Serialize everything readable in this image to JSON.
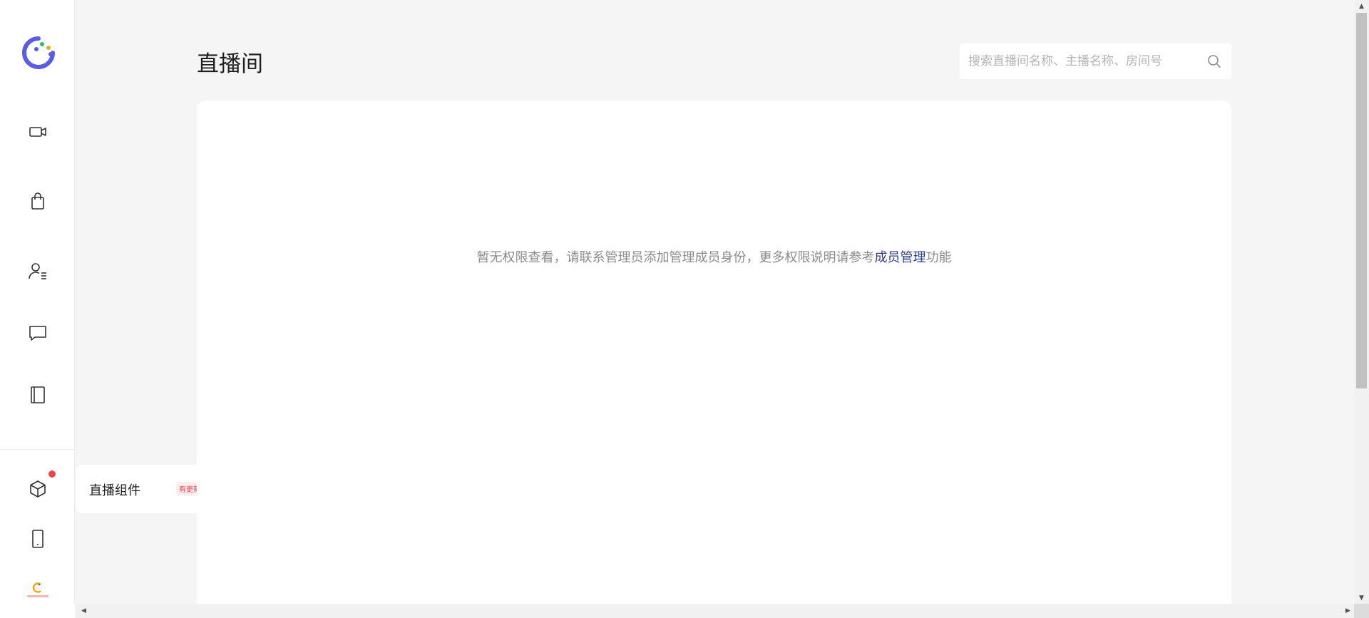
{
  "header": {
    "title": "直播间"
  },
  "search": {
    "placeholder": "搜索直播间名称、主播名称、房间号"
  },
  "main": {
    "empty_text": "暂无权限查看，请联系管理员添加管理成员身份，更多权限说明请参考",
    "empty_link": "成员管理",
    "empty_suffix": "功能"
  },
  "sidebar": {
    "items": [
      {
        "icon": "video-camera-icon"
      },
      {
        "icon": "shopping-bag-icon"
      },
      {
        "icon": "user-list-icon"
      },
      {
        "icon": "message-icon"
      },
      {
        "icon": "book-icon"
      },
      {
        "icon": "cube-icon"
      },
      {
        "icon": "tablet-icon"
      }
    ],
    "flyout": {
      "label": "直播组件",
      "badge": "有更新"
    }
  },
  "colors": {
    "accent": "#5b5ce6",
    "link": "#2e4187",
    "badge_red": "#f0414b",
    "background": "#f5f5f6"
  }
}
